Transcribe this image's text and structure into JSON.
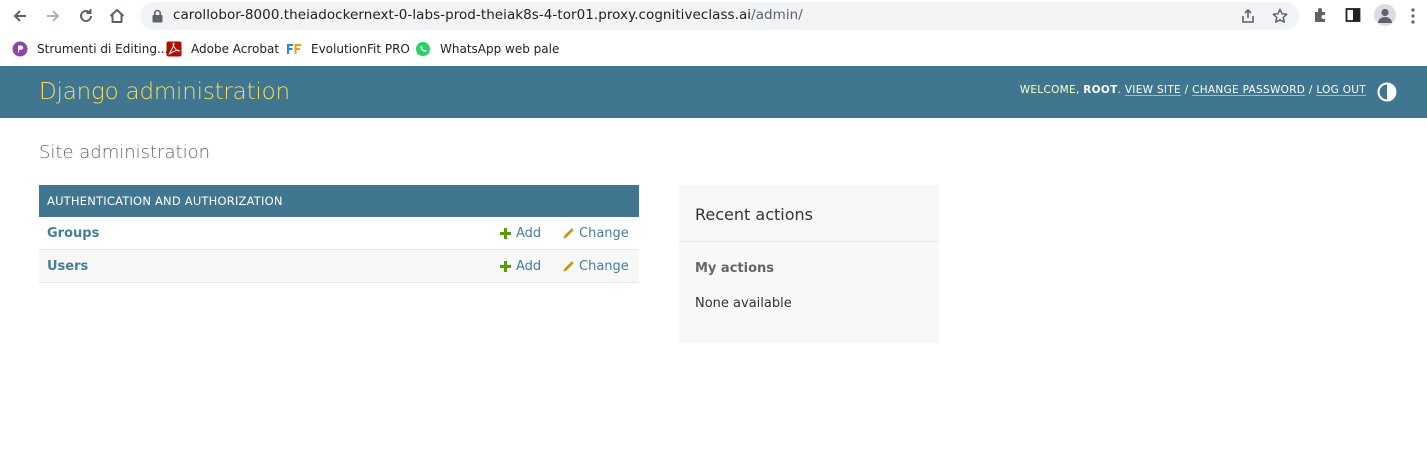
{
  "browser": {
    "url_host": "carollobor-8000.theiadockernext-0-labs-prod-theiak8s-4-tor01.proxy.cognitiveclass.ai",
    "url_path": "/admin/",
    "bookmarks": [
      {
        "label": "Strumenti di Editing...",
        "icon": "editing-tools-icon",
        "color": "#8e44ad"
      },
      {
        "label": "Adobe Acrobat",
        "icon": "acrobat-icon",
        "color": "#b30b00"
      },
      {
        "label": "EvolutionFit PRO",
        "icon": "ef-icon",
        "color": "#1e88e5"
      },
      {
        "label": "WhatsApp web pale",
        "icon": "whatsapp-icon",
        "color": "#25d366"
      }
    ]
  },
  "header": {
    "branding": "Django administration",
    "welcome": "WELCOME,",
    "username": "ROOT",
    "period": ".",
    "view_site": "VIEW SITE",
    "change_password": "CHANGE PASSWORD",
    "log_out": "LOG OUT",
    "separator": " / "
  },
  "content": {
    "title": "Site administration",
    "module": {
      "caption": "AUTHENTICATION AND AUTHORIZATION",
      "models": [
        {
          "name": "Groups",
          "add": "Add",
          "change": "Change"
        },
        {
          "name": "Users",
          "add": "Add",
          "change": "Change"
        }
      ]
    },
    "recent": {
      "title": "Recent actions",
      "subtitle": "My actions",
      "empty": "None available"
    }
  },
  "colors": {
    "header_bg": "#417690",
    "branding": "#f5dd5d",
    "link": "#447e9b",
    "add_icon": "#5b980b",
    "change_icon": "#c29a17"
  }
}
